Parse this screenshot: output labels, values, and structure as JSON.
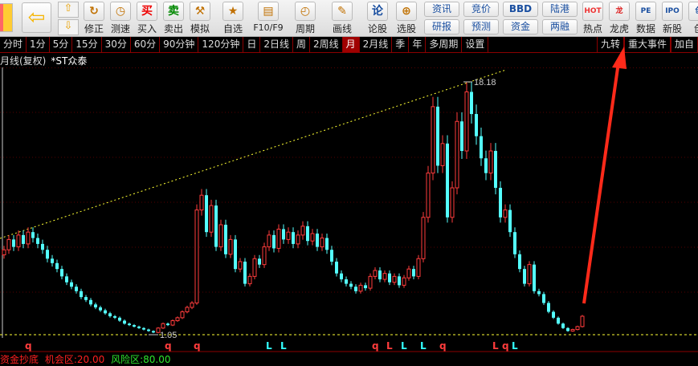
{
  "toolbar": {
    "buttons": [
      {
        "label": "修正",
        "icon": "refresh-icon"
      },
      {
        "label": "测速",
        "icon": "clock-icon"
      },
      {
        "label": "买入",
        "icon": "buy-icon",
        "glyph": "买"
      },
      {
        "label": "卖出",
        "icon": "sell-icon",
        "glyph": "卖"
      },
      {
        "label": "模拟",
        "icon": "gavel-icon"
      },
      {
        "label": "自选",
        "icon": "folder-star-icon"
      },
      {
        "label": "F10/F9",
        "icon": "f10-icon"
      },
      {
        "label": "周期",
        "icon": "period-clock-icon"
      },
      {
        "label": "画线",
        "icon": "pencil-icon"
      },
      {
        "label": "论股",
        "icon": "discuss-icon",
        "glyph": "论"
      },
      {
        "label": "选股",
        "icon": "stock-picker-icon"
      }
    ],
    "small_buttons": [
      "资讯",
      "研报",
      "竞价",
      "预测",
      "BBD",
      "资金",
      "陆港",
      "两融"
    ],
    "right_buttons": [
      {
        "label": "热点",
        "icon": "hot-icon",
        "glyph": "HOT"
      },
      {
        "label": "龙虎",
        "icon": "dragon-icon",
        "glyph": "龙"
      },
      {
        "label": "数据",
        "icon": "pe-icon",
        "glyph": "PE"
      },
      {
        "label": "新股",
        "icon": "ipo-icon",
        "glyph": "IPO"
      },
      {
        "label": "创",
        "icon": "create-icon",
        "glyph": "创"
      }
    ]
  },
  "tabs": [
    "分时",
    "1分",
    "5分",
    "15分",
    "30分",
    "60分",
    "90分钟",
    "120分钟",
    "日",
    "2日线",
    "周",
    "2周线",
    "月",
    "2月线",
    "季",
    "年",
    "多周期",
    "设置"
  ],
  "active_tab": "月",
  "right_tabs": [
    "九转",
    "重大事件",
    "加自"
  ],
  "title": {
    "period": "月线(复权)",
    "stock": "*ST众泰"
  },
  "chart_data": {
    "type": "candlestick",
    "high_label": "18.18",
    "low_label": "1.05",
    "y_max": 18.18,
    "y_min": 1.05,
    "closes": [
      6.8,
      7.5,
      7.0,
      7.8,
      7.2,
      8.0,
      7.6,
      7.2,
      6.8,
      6.2,
      5.9,
      5.5,
      5.0,
      4.6,
      4.3,
      4.0,
      3.6,
      3.4,
      3.1,
      2.9,
      2.7,
      2.5,
      2.3,
      2.2,
      2.0,
      1.8,
      1.7,
      1.6,
      1.5,
      1.4,
      1.3,
      1.2,
      1.5,
      1.8,
      1.7,
      2.0,
      2.2,
      2.6,
      2.9,
      3.2,
      9.5,
      10.5,
      8.0,
      9.8,
      7.0,
      8.5,
      6.5,
      7.5,
      5.5,
      6.0,
      4.5,
      5.0,
      6.2,
      5.8,
      7.0,
      7.8,
      6.9,
      8.2,
      7.5,
      8.0,
      7.2,
      7.8,
      8.4,
      7.4,
      7.9,
      7.0,
      7.6,
      6.8,
      6.0,
      5.2,
      4.8,
      4.5,
      4.3,
      4.0,
      4.4,
      4.2,
      5.0,
      5.4,
      4.8,
      5.2,
      4.6,
      5.0,
      4.4,
      4.9,
      5.5,
      5.0,
      6.2,
      9.0,
      12.0,
      16.5,
      12.5,
      14.0,
      9.0,
      11.0,
      15.5,
      13.5,
      17.5,
      16.0,
      14.5,
      13.0,
      12.0,
      13.5,
      11.0,
      9.0,
      9.5,
      8.0,
      6.5,
      5.5,
      4.5,
      5.8,
      4.0,
      3.8,
      3.2,
      2.6,
      2.2,
      1.8,
      1.5,
      1.3,
      1.4,
      1.6,
      2.3
    ],
    "signals": [
      {
        "i": 5,
        "t": "q",
        "c": "#ff3c3c"
      },
      {
        "i": 34,
        "t": "q",
        "c": "#ff3c3c"
      },
      {
        "i": 40,
        "t": "q",
        "c": "#ff3c3c"
      },
      {
        "i": 55,
        "t": "L",
        "c": "#33ffff"
      },
      {
        "i": 58,
        "t": "L",
        "c": "#33ffff"
      },
      {
        "i": 77,
        "t": "q",
        "c": "#ff3c3c"
      },
      {
        "i": 80,
        "t": "L",
        "c": "#ff3c3c"
      },
      {
        "i": 83,
        "t": "L",
        "c": "#33ffff"
      },
      {
        "i": 87,
        "t": "L",
        "c": "#33ffff"
      },
      {
        "i": 91,
        "t": "q",
        "c": "#ff3c3c"
      },
      {
        "i": 102,
        "t": "L",
        "c": "#ff3c3c"
      },
      {
        "i": 104,
        "t": "q",
        "c": "#ff3c3c"
      },
      {
        "i": 106,
        "t": "L",
        "c": "#33ffff"
      }
    ],
    "up_color": "#ff3c3c",
    "down_color": "#54ffff",
    "trend_color": "#ffff33"
  },
  "bottom": {
    "name": "资金抄底",
    "opp_label": "机会区:",
    "opp_value": "20.00",
    "risk_label": "风险区:",
    "risk_value": "80.00"
  }
}
